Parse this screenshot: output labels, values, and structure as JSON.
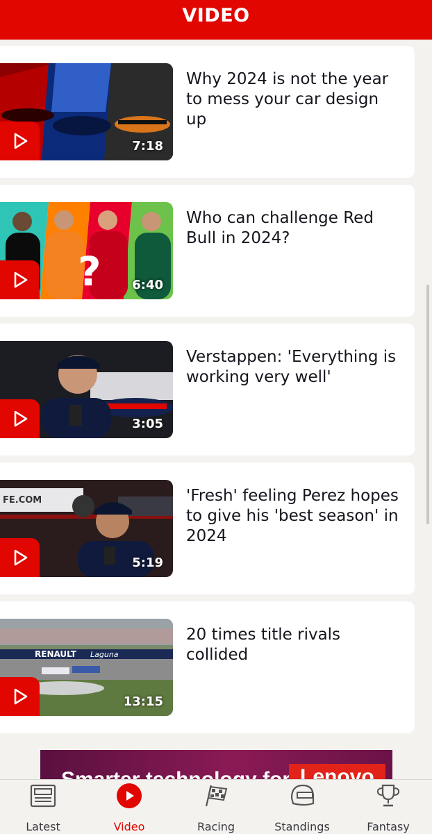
{
  "header": {
    "title": "VIDEO"
  },
  "videos": [
    {
      "title": "Why 2024 is not the year to mess your car design up",
      "duration": "7:18"
    },
    {
      "title": "Who can challenge Red Bull in 2024?",
      "duration": "6:40"
    },
    {
      "title": "Verstappen: 'Everything is working very well'",
      "duration": "3:05"
    },
    {
      "title": "'Fresh' feeling Perez hopes to give his 'best season' in 2024",
      "duration": "5:19"
    },
    {
      "title": "20 times title rivals collided",
      "duration": "13:15"
    }
  ],
  "thumb_text": {
    "renault": "RENAULT",
    "laguna": "Laguna",
    "fe": "FE.COM"
  },
  "ad": {
    "text": "Smarter technology for all",
    "brand": "Lenovo"
  },
  "tabs": [
    {
      "label": "Latest",
      "icon": "news-icon"
    },
    {
      "label": "Video",
      "icon": "play-circle-icon",
      "active": true
    },
    {
      "label": "Racing",
      "icon": "checkered-flag-icon"
    },
    {
      "label": "Standings",
      "icon": "helmet-icon"
    },
    {
      "label": "Fantasy",
      "icon": "trophy-icon"
    }
  ],
  "colors": {
    "accent": "#e10600",
    "background": "#f4f2ef",
    "text": "#15151e"
  }
}
